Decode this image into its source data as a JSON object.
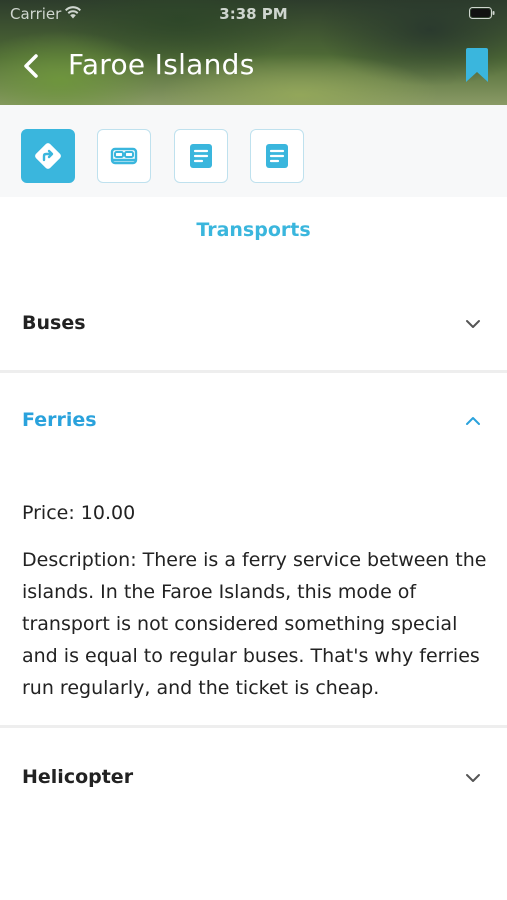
{
  "status_bar": {
    "carrier": "Carrier",
    "time": "3:38 PM"
  },
  "header": {
    "title": "Faroe Islands"
  },
  "icons": {
    "back": "chevron-left-icon",
    "bookmark": "bookmark-icon",
    "categories": [
      "directions-icon",
      "bed-icon",
      "document-icon",
      "document-icon"
    ]
  },
  "section_title": "Transports",
  "accordion": [
    {
      "title": "Buses",
      "expanded": false
    },
    {
      "title": "Ferries",
      "expanded": true,
      "price": "Price: 10.00",
      "description": "Description: There is a ferry service between the islands. In the Faroe Islands, this mode of transport is not considered something special and is equal to regular buses. That's why ferries run regularly, and the ticket is cheap."
    },
    {
      "title": "Helicopter",
      "expanded": false
    }
  ],
  "colors": {
    "accent": "#3ab6dd",
    "expanded_title": "#2aa2dc"
  }
}
